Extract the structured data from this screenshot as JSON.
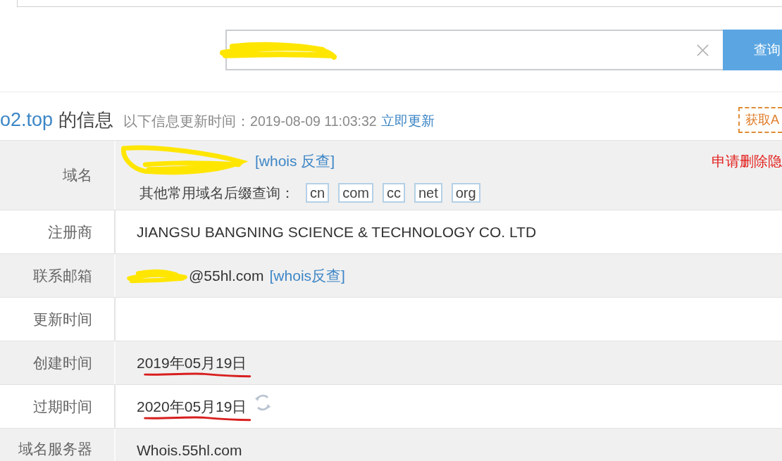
{
  "search": {
    "redacted": true,
    "button": "查询"
  },
  "header": {
    "domain": "o2.top",
    "title": "的信息",
    "update_note": "以下信息更新时间：2019-08-09 11:03:32",
    "update_link": "立即更新",
    "action": "获取A"
  },
  "rows": [
    {
      "kind": "domain",
      "label": "域名",
      "redacted": true,
      "underlined": false,
      "link": "[whois 反查]",
      "note": "申请删除隐",
      "suffix_label": "其他常用域名后缀查询：",
      "suffixes": [
        "cn",
        "com",
        "cc",
        "net",
        "org"
      ]
    },
    {
      "kind": "text",
      "label": "注册商",
      "redacted": false,
      "underlined": false,
      "value": "JIANGSU BANGNING SCIENCE & TECHNOLOGY CO. LTD"
    },
    {
      "kind": "email",
      "label": "联系邮箱",
      "redacted": true,
      "underlined": false,
      "value": "@55hl.com",
      "link": "[whois反查]"
    },
    {
      "kind": "text",
      "label": "更新时间",
      "redacted": false,
      "underlined": false
    },
    {
      "kind": "date",
      "label": "创建时间",
      "redacted": false,
      "underlined": true,
      "value": "2019年05月19日"
    },
    {
      "kind": "expiry",
      "label": "过期时间",
      "redacted": false,
      "underlined": true,
      "value": "2020年05月19日"
    },
    {
      "kind": "text",
      "label": "域名服务器",
      "redacted": false,
      "underlined": false,
      "value": "Whois.55hl.com"
    }
  ]
}
